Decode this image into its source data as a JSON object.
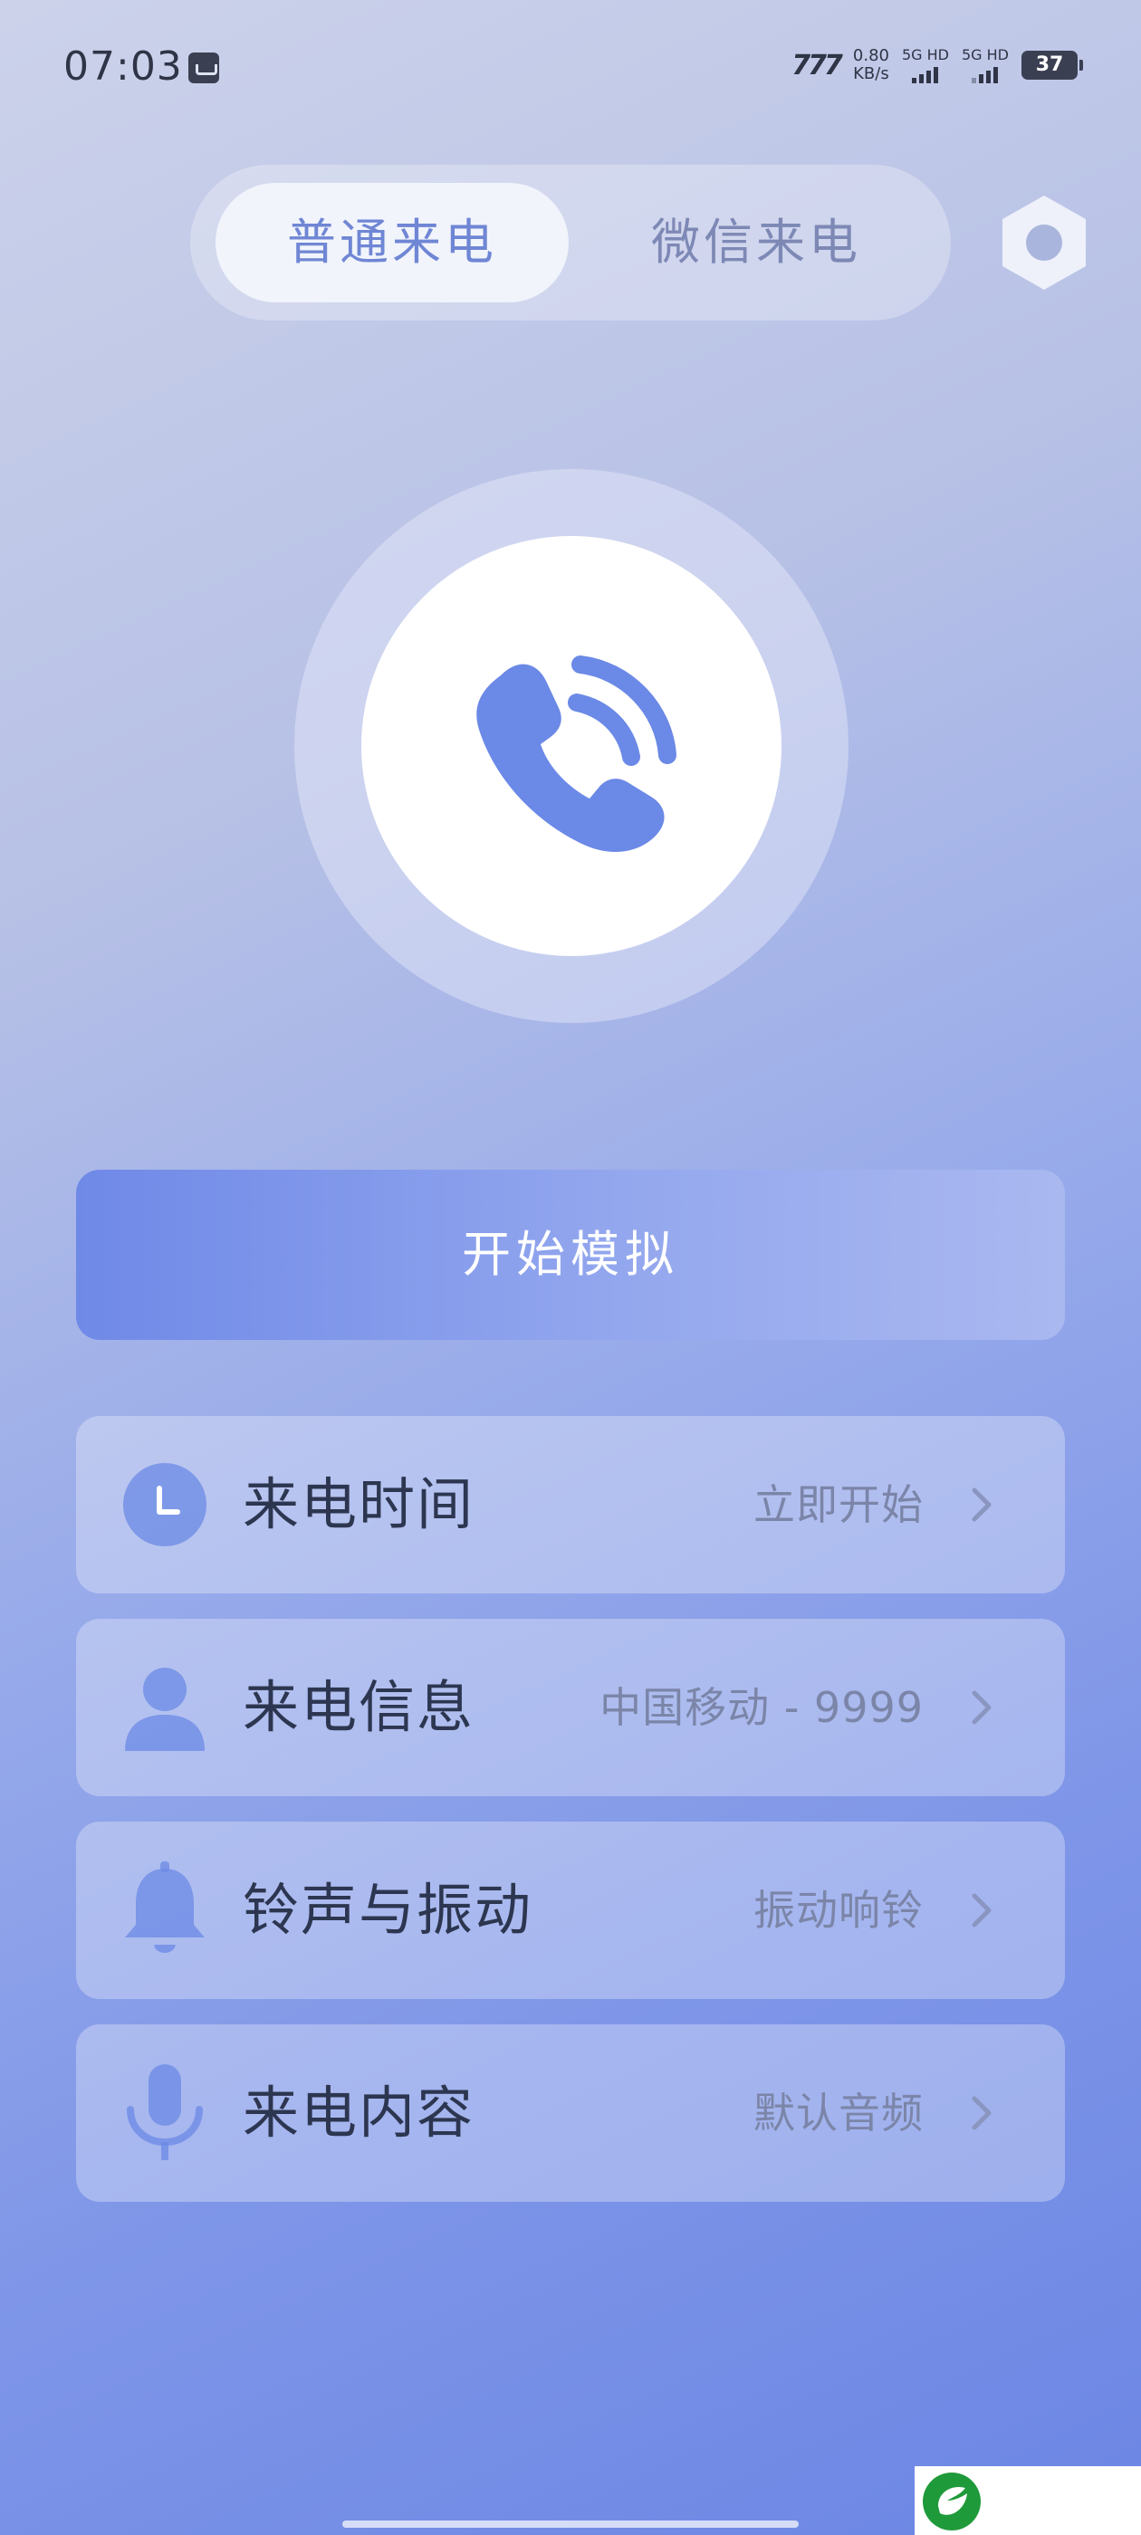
{
  "status_bar": {
    "time": "07:03",
    "net_logo": "777",
    "net_speed_value": "0.80",
    "net_speed_unit": "KB/s",
    "sim1": "5G HD",
    "sim2": "5G HD",
    "battery": "37"
  },
  "tabs": [
    {
      "label": "普通来电",
      "active": true
    },
    {
      "label": "微信来电",
      "active": false
    }
  ],
  "icons": {
    "settings": "hexagon-settings-icon",
    "call": "phone-ringing-icon"
  },
  "start_button": {
    "label": "开始模拟"
  },
  "rows": [
    {
      "label": "来电时间",
      "value": "立即开始",
      "icon": "clock-icon"
    },
    {
      "label": "来电信息",
      "value": "中国移动 - 9999",
      "icon": "person-icon"
    },
    {
      "label": "铃声与振动",
      "value": "振动响铃",
      "icon": "bell-icon"
    },
    {
      "label": "来电内容",
      "value": "默认音频",
      "icon": "microphone-icon"
    }
  ],
  "colors": {
    "accent": "#6f86d4",
    "icon_blue": "#6b89e6",
    "start_button": "#7a91ea"
  }
}
